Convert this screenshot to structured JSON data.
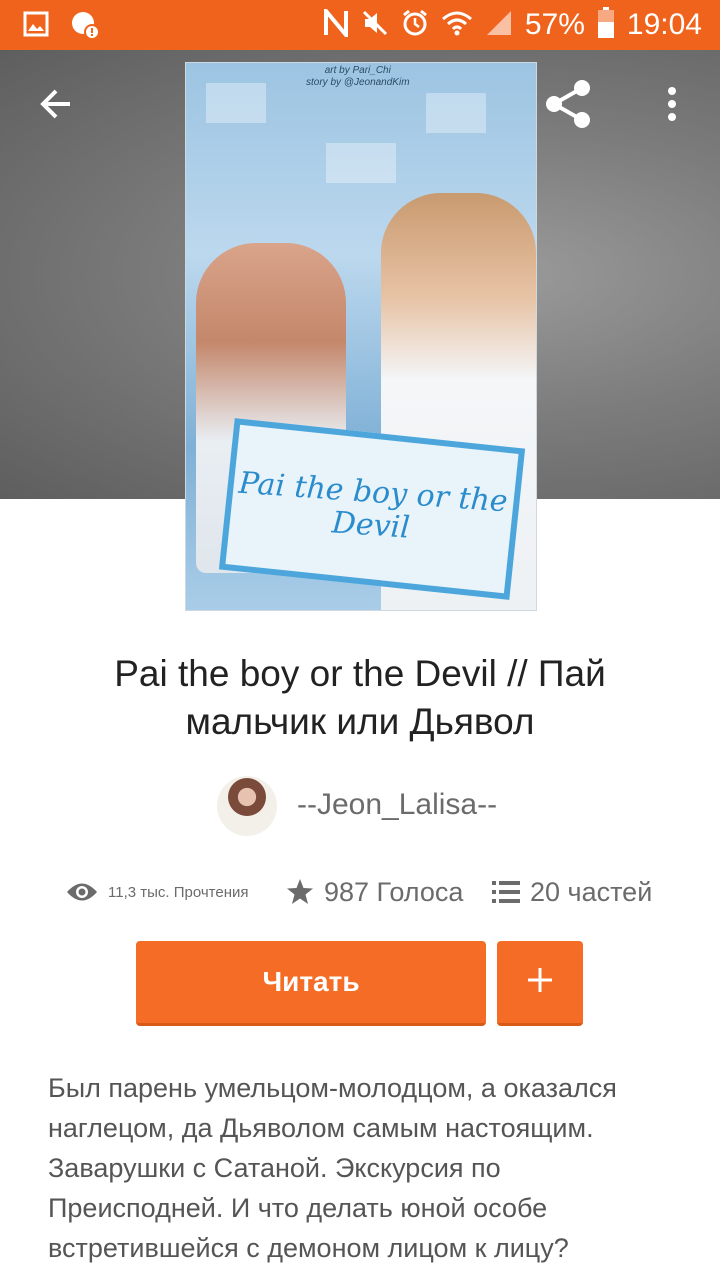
{
  "status_bar": {
    "battery": "57%",
    "time": "19:04",
    "icons": [
      "gallery-icon",
      "alert-icon",
      "nfc-icon",
      "mute-icon",
      "alarm-icon",
      "wifi-icon",
      "signal-icon",
      "battery-icon"
    ]
  },
  "header": {
    "back_icon": "arrow-left-icon",
    "share_icon": "share-icon",
    "more_icon": "more-vert-icon"
  },
  "cover": {
    "text": "Pai the boy or the Devil",
    "credit_line1": "art by Pari_Chi",
    "credit_line2": "story by @JeonandKim"
  },
  "story": {
    "title": "Pai the boy or the Devil // Пай мальчик или Дьявол",
    "author": "--Jeon_Lalisa--",
    "reads": "11,3 тыс. Прочтения",
    "votes": "987 Голоса",
    "parts": "20 частей",
    "description": "Был парень умельцом-молодцом, а оказался наглецом, да Дьяволом самым настоящим. Заварушки с Сатаной. Экскурсия по Преисподней. И что делать юной особе встретившейся с демоном лицом к лицу?"
  },
  "actions": {
    "read_label": "Читать",
    "add_icon": "plus-icon"
  },
  "colors": {
    "accent": "#f46c25",
    "status_bar": "#f0631d"
  }
}
